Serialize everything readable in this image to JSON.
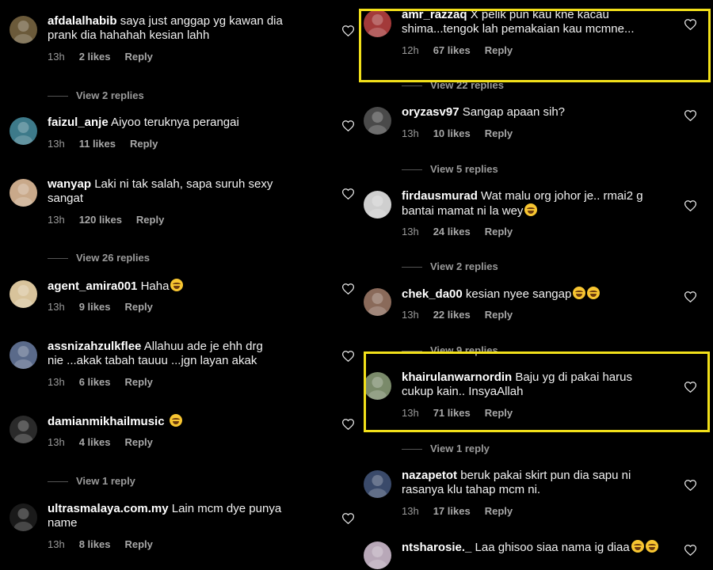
{
  "colors": {
    "highlight": "#f2e01a",
    "background": "#000000"
  },
  "left_column": [
    {
      "username": "afdalalhabib",
      "text": "saya just anggap yg kawan dia\nprank dia hahahah kesian lahh",
      "time": "13h",
      "likes": "2 likes",
      "reply": "Reply",
      "view_replies": "View 2 replies",
      "avatar_color": "#6b5a3a"
    },
    {
      "username": "faizul_anje",
      "text": "Aiyoo teruknya perangai",
      "time": "13h",
      "likes": "11 likes",
      "reply": "Reply",
      "view_replies": "",
      "avatar_color": "#3d7a8a"
    },
    {
      "username": "wanyap",
      "text": "Laki ni tak salah, sapa suruh sexy\nsangat",
      "time": "13h",
      "likes": "120 likes",
      "reply": "Reply",
      "view_replies": "View 26 replies",
      "avatar_color": "#c9a98a"
    },
    {
      "username": "agent_amira001",
      "text": "Haha",
      "emoji_count": 1,
      "time": "13h",
      "likes": "9 likes",
      "reply": "Reply",
      "view_replies": "",
      "avatar_color": "#d8c39b"
    },
    {
      "username": "assnizahzulkflee",
      "text": "Allahuu ade je ehh drg\nnie ...akak tabah tauuu ...jgn layan akak",
      "time": "13h",
      "likes": "6 likes",
      "reply": "Reply",
      "view_replies": "",
      "avatar_color": "#5a6a8a"
    },
    {
      "username": "damianmikhailmusic",
      "text": "",
      "emoji_count": 1,
      "time": "13h",
      "likes": "4 likes",
      "reply": "Reply",
      "view_replies": "View 1 reply",
      "avatar_color": "#2a2a2a"
    },
    {
      "username": "ultrasmalaya.com.my",
      "text": "Lain mcm dye punya\nname",
      "time": "13h",
      "likes": "8 likes",
      "reply": "Reply",
      "view_replies": "",
      "avatar_color": "#1a1a1a"
    }
  ],
  "right_column": [
    {
      "username": "amr_razzaq",
      "text": "X pelik pun kau kne kacau\nshima...tengok lah pemakaian kau mcmne...",
      "time": "12h",
      "likes": "67 likes",
      "reply": "Reply",
      "view_replies": "View 22 replies",
      "avatar_color": "#a33a3a"
    },
    {
      "username": "oryzasv97",
      "text": "Sangap apaan sih?",
      "time": "13h",
      "likes": "10 likes",
      "reply": "Reply",
      "view_replies": "View 5 replies",
      "avatar_color": "#4a4a4a"
    },
    {
      "username": "firdausmurad",
      "text": "Wat malu org johor je.. rmai2 g\nbantai mamat ni la wey",
      "emoji_count": 1,
      "time": "13h",
      "likes": "24 likes",
      "reply": "Reply",
      "view_replies": "View 2 replies",
      "avatar_color": "#cfcfcf"
    },
    {
      "username": "chek_da00",
      "text": "kesian nyee sangap",
      "emoji_count": 2,
      "time": "13h",
      "likes": "22 likes",
      "reply": "Reply",
      "view_replies": "View 9 replies",
      "avatar_color": "#8a6a5a"
    },
    {
      "username": "khairulanwarnordin",
      "text": "Baju yg di pakai harus\ncukup kain.. InsyaAllah",
      "time": "13h",
      "likes": "71 likes",
      "reply": "Reply",
      "view_replies": "View 1 reply",
      "avatar_color": "#7a8a6a"
    },
    {
      "username": "nazapetot",
      "text": "beruk pakai skirt pun dia sapu ni\nrasanya klu tahap mcm ni.",
      "time": "13h",
      "likes": "17 likes",
      "reply": "Reply",
      "view_replies": "",
      "avatar_color": "#3a4a6a"
    },
    {
      "username": "ntsharosie._",
      "text": "Laa ghisoo siaa nama ig diaa",
      "emoji_count": 2,
      "time": "",
      "likes": "",
      "reply": "",
      "view_replies": "",
      "avatar_color": "#b8a8b8"
    }
  ]
}
